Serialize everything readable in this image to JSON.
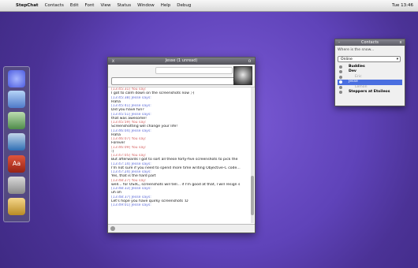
{
  "menubar": {
    "apple": "",
    "app_name": "StepChat",
    "menus": [
      "Contacts",
      "Edit",
      "Font",
      "View",
      "Status",
      "Window",
      "Help",
      "Debug"
    ],
    "clock": "Tue 13:46"
  },
  "dock": {
    "icons": [
      "finder-icon",
      "pen-tool-icon",
      "leaf-icon",
      "globe-icon",
      "adobe-icon",
      "calculator-icon",
      "archive-icon"
    ],
    "adobe_label": "Aa"
  },
  "chat_window": {
    "title": "Jesse (1 unread)",
    "close_glyph": "x",
    "zoom_glyph": "o",
    "messages": [
      {
        "header": "[13:45:31] You say:",
        "is_me": true,
        "text": ""
      },
      {
        "header": "",
        "is_me": false,
        "text": "I got to calm down on the screenshots now ;-)"
      },
      {
        "header": "[13:45:38] Jesse says:",
        "is_me": false,
        "text": "Haha"
      },
      {
        "header": "[13:45:41] Jesse says:",
        "is_me": false,
        "text": "Did you have fun?"
      },
      {
        "header": "[13:45:51] Jesse says:",
        "is_me": false,
        "text": "that was awesome!"
      },
      {
        "header": "[13:45:59] You say:",
        "is_me": true,
        "text": "Screenshotting will change your life!"
      },
      {
        "header": "[13:46:04] Jesse says:",
        "is_me": false,
        "text": "Haha"
      },
      {
        "header": "[13:46:07] You say:",
        "is_me": true,
        "text": "Forever"
      },
      {
        "header": "[13:46:09] You say:",
        "is_me": true,
        "text": ":)"
      },
      {
        "header": "[13:47:05] You say:",
        "is_me": true,
        "text": "But afterwards I got to sort all these forty-five screenshots to pick the"
      },
      {
        "header": "[13:47:14] Jesse says:",
        "is_me": false,
        "text": "I'm not sure if you need to spend more time writing Objective-C code..."
      },
      {
        "header": "[13:47:24] Jesse says:",
        "is_me": false,
        "text": "Yes, that is the hard part"
      },
      {
        "header": "[13:48:27] You say:",
        "is_me": true,
        "text": "well... for OS4C, screenshots will tell... if I'm good at that, I will resign s"
      },
      {
        "header": "[13:48:33] Jesse says:",
        "is_me": false,
        "text": "uh oh"
      },
      {
        "header": "[13:48:37] Jesse says:",
        "is_me": false,
        "text": "Let's hope you have quirky screenshots :D"
      },
      {
        "header": "[13:49:01] Jesse says:",
        "is_me": false,
        "text": ""
      }
    ]
  },
  "contacts_window": {
    "title": "Contacts",
    "close_glyph": "x",
    "menu_glyph": "-",
    "status_message_placeholder": "Where is the snow...",
    "status": "Online",
    "items": [
      {
        "label": "Buddies",
        "type": "group",
        "selected": false
      },
      {
        "label": "Dev",
        "type": "group",
        "selected": false
      },
      {
        "label": "Eric",
        "type": "sub",
        "selected": false
      },
      {
        "label": "Jesse",
        "type": "contact",
        "selected": true
      },
      {
        "label": "Lemon",
        "type": "sub",
        "selected": false
      },
      {
        "label": "Steppers at Etoileos",
        "type": "group",
        "selected": false
      }
    ]
  }
}
